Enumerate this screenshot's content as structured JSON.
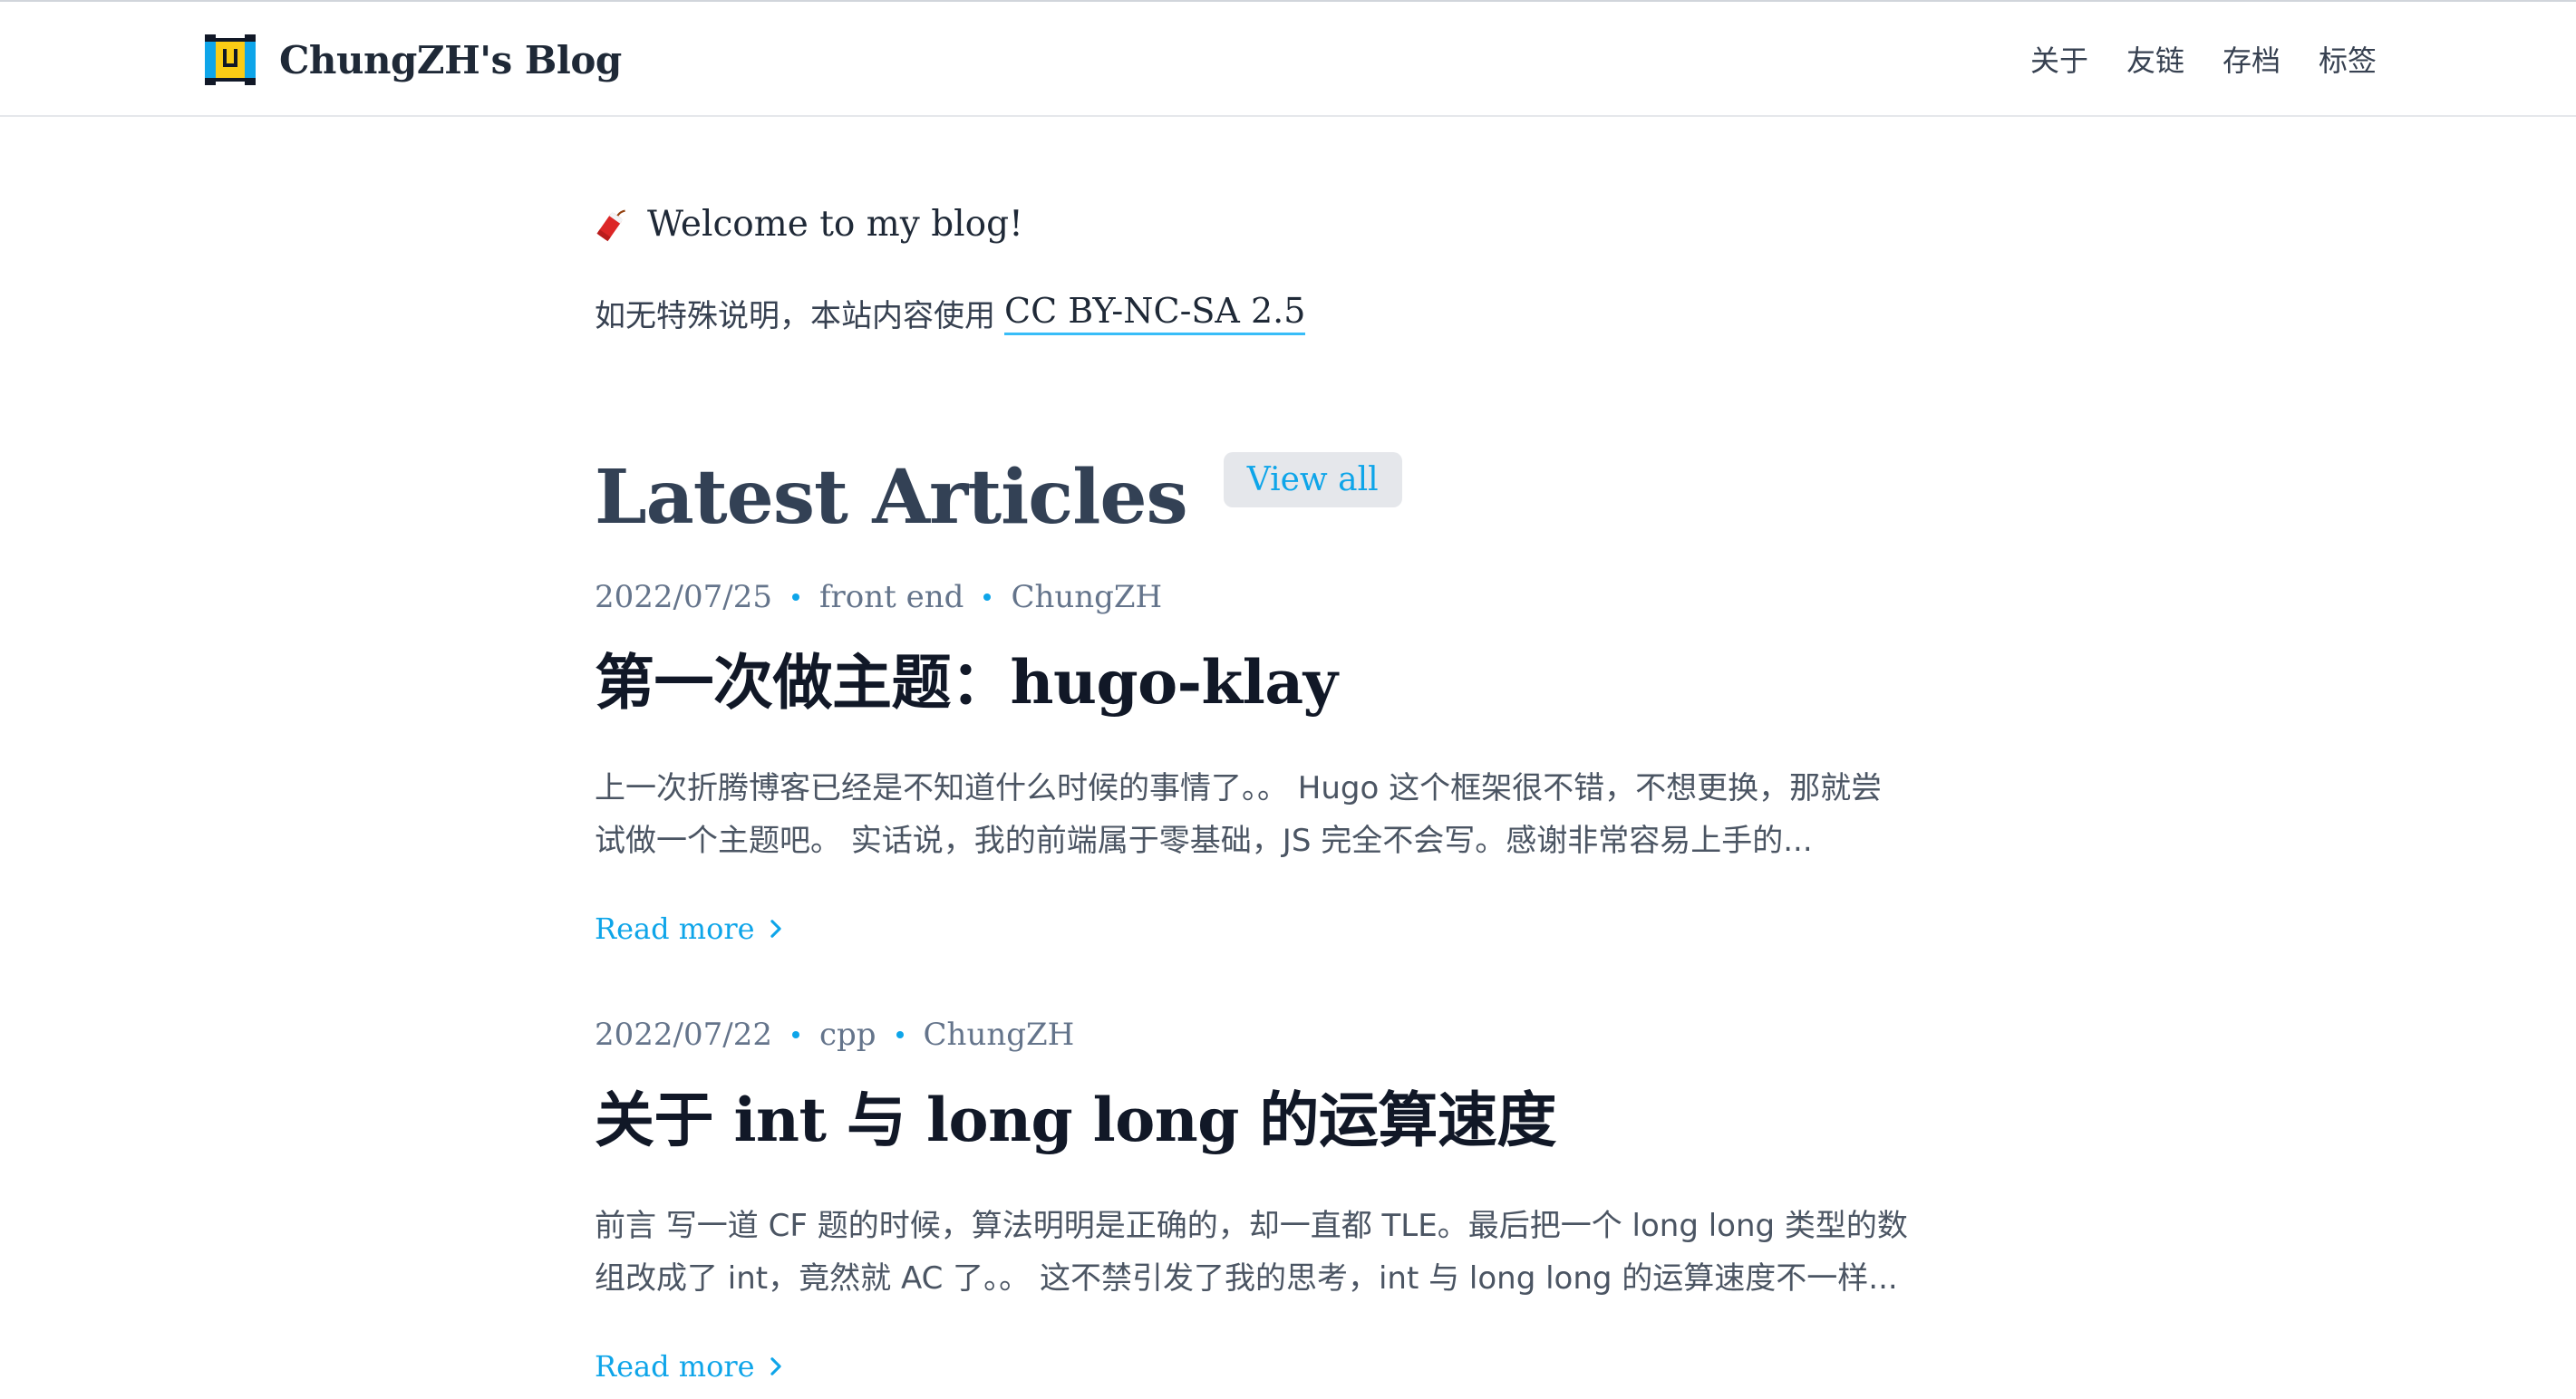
{
  "header": {
    "brand": "ChungZH's Blog",
    "nav": [
      "关于",
      "友链",
      "存档",
      "标签"
    ]
  },
  "intro": {
    "welcome": "Welcome to my blog!",
    "license_prefix": "如无特殊说明，本站内容使用",
    "license_link": "CC BY-NC-SA 2.5"
  },
  "latest": {
    "title": "Latest Articles",
    "view_all": "View all"
  },
  "articles": [
    {
      "date": "2022/07/25",
      "category": "front end",
      "author": "ChungZH",
      "title": "第一次做主题：hugo-klay",
      "summary_line1": "上一次折腾博客已经是不知道什么时候的事情了。。 Hugo 这个框架很不错，不想更换，那就尝",
      "summary_line2": "试做一个主题吧。 实话说，我的前端属于零基础，JS 完全不会写。感谢非常容易上手的...",
      "read_more": "Read more"
    },
    {
      "date": "2022/07/22",
      "category": "cpp",
      "author": "ChungZH",
      "title": "关于 int 与 long long 的运算速度",
      "summary_line1": "前言 写一道 CF 题的时候，算法明明是正确的，却一直都 TLE。最后把一个 long long 类型的数",
      "summary_line2": "组改成了 int，竟然就 AC 了。。 这不禁引发了我的思考，int 与 long long 的运算速度不一样...",
      "read_more": "Read more"
    }
  ],
  "colors": {
    "accent": "#0ea5e9",
    "link_underline": "#38bdf8",
    "heading": "#334155"
  }
}
